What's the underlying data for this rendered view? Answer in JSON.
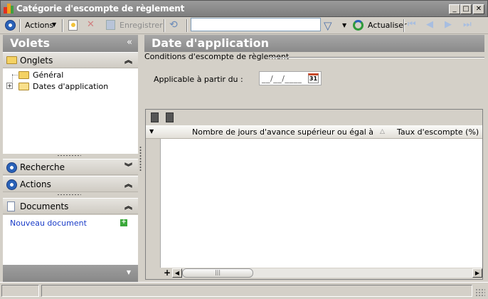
{
  "window": {
    "title": "Catégorie d'escompte de règlement"
  },
  "toolbar": {
    "actions_label": "Actions",
    "save_label": "Enregistrer",
    "search_value": "",
    "refresh_label": "Actualiser"
  },
  "left_panel": {
    "title": "Volets",
    "onglets": {
      "label": "Onglets",
      "items": [
        {
          "label": "Général",
          "expander": ""
        },
        {
          "label": "Dates d'application",
          "expander": "+"
        }
      ]
    },
    "recherche_label": "Recherche",
    "actions_label": "Actions",
    "documents": {
      "label": "Documents",
      "new_doc_label": "Nouveau document"
    }
  },
  "main": {
    "title": "Date d'application",
    "group_label": "Conditions d'escompte de règlement",
    "applicable_label": "Applicable à partir du :",
    "date_value": "__/__/____",
    "calendar_day": "31",
    "grid": {
      "columns": [
        "Nombre de jours d'avance supérieur ou égal à",
        "Taux d'escompte (%)"
      ],
      "rows": [],
      "add_label": "+"
    }
  },
  "colors": {
    "accent": "#2a62b8",
    "header_gray": "#8a8a8a"
  }
}
